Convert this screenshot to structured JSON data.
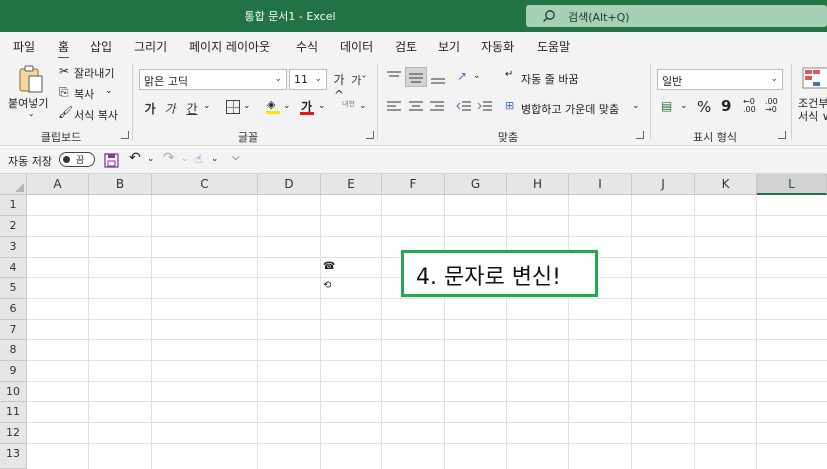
{
  "titlebar": {
    "title": "통합 문서1  -  Excel",
    "search_placeholder": "검색(Alt+Q)",
    "bg_color": "#217346"
  },
  "menu": {
    "tabs": [
      "파일",
      "홈",
      "삽입",
      "그리기",
      "페이지 레이아웃",
      "수식",
      "데이터",
      "검토",
      "보기",
      "자동화",
      "도움말"
    ],
    "active": "홈"
  },
  "ribbon": {
    "clipboard": {
      "paste_label": "붙여넣기",
      "cut_label": "잘라내기",
      "copy_label": "복사",
      "format_painter_label": "서식 복사",
      "group_label": "클립보드"
    },
    "font": {
      "font_name": "맑은 고딕",
      "font_size": "11",
      "increase_label": "가^",
      "decrease_label": "가ˇ",
      "bold": "가",
      "italic": "가",
      "underline": "간",
      "font_color_glyph": "가",
      "phonetic_label": "내천",
      "group_label": "글꼴"
    },
    "alignment": {
      "wrap_label": "자동 줄 바꿈",
      "merge_label": "병합하고 가운데 맞춤",
      "group_label": "맞춤"
    },
    "number": {
      "format": "일반",
      "percent": "%",
      "comma": "9",
      "inc_decimal": "←0 .00",
      "dec_decimal": ".00 →0",
      "group_label": "표시 형식"
    },
    "styles": {
      "cond_label_1": "조건부",
      "cond_label_2": "서식 ∨"
    }
  },
  "qat": {
    "autosave_label": "자동 저장",
    "toggle_label": "끔"
  },
  "sheet": {
    "columns": [
      "A",
      "B",
      "C",
      "D",
      "E",
      "F",
      "G",
      "H",
      "I",
      "J",
      "K",
      "L"
    ],
    "selected_column": "L",
    "rows": [
      "1",
      "2",
      "3",
      "4",
      "5",
      "6",
      "7",
      "8",
      "9",
      "10",
      "11",
      "12",
      "13"
    ],
    "callout_text": "4. 문자로 변신!",
    "callout_color": "#1faa4f",
    "cell_icons": [
      "phone-icon",
      "sync-circle-icon"
    ]
  }
}
